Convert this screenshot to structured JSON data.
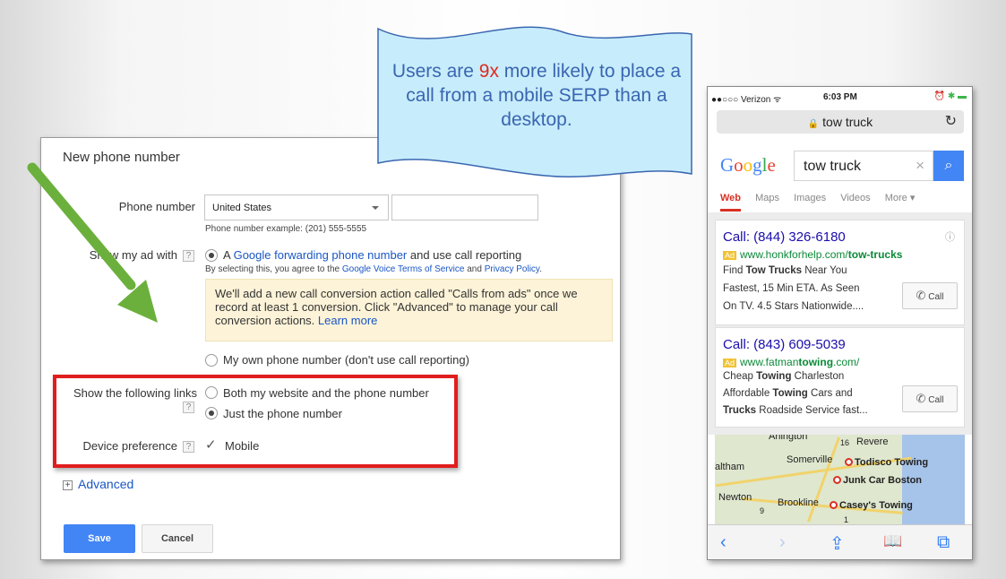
{
  "callout": {
    "text_before": "Users are ",
    "highlight": "9x",
    "text_after": " more likely to place a call from a mobile SERP than a desktop."
  },
  "dialog": {
    "title": "New phone number",
    "phone_number_label": "Phone number",
    "country_selected": "United States",
    "phone_input_value": "",
    "phone_example": "Phone number example: (201) 555-5555",
    "show_ad_label": "Show my ad with",
    "help_glyph": "?",
    "option_forwarding_prefix": "A ",
    "option_forwarding_link": "Google forwarding phone number",
    "option_forwarding_suffix": " and use call reporting",
    "terms_prefix": "By selecting this, you agree to the ",
    "terms_link": "Google Voice Terms of Service",
    "terms_and": " and ",
    "privacy_link": "Privacy Policy",
    "terms_end": ".",
    "info_text": "We'll add a new call conversion action called \"Calls from ads\" once we record at least 1 conversion. Click \"Advanced\" to manage your call conversion actions. ",
    "learn_more": "Learn more",
    "option_own_number": "My own phone number (don't use call reporting)",
    "links_label": "Show the following links",
    "links_option_both": "Both my website and the phone number",
    "links_option_phone": "Just the phone number",
    "device_label": "Device preference",
    "device_check": "✓",
    "device_option": "Mobile",
    "advanced_plus": "+",
    "advanced_label": "Advanced",
    "save_label": "Save",
    "cancel_label": "Cancel"
  },
  "phone": {
    "carrier": "●●○○○ Verizon ᯤ",
    "time": "6:03 PM",
    "status_right": "⏰ ✱ ▬",
    "url_lock": "🔒",
    "url_text": "tow truck",
    "reload": "↻",
    "logo": "Google",
    "search_value": "tow truck",
    "clear": "×",
    "search_glyph": "⌕",
    "tabs": [
      "Web",
      "Maps",
      "Images",
      "Videos",
      "More ▾"
    ],
    "ads": [
      {
        "title": "Call: (844) 326-6180",
        "badge": "Ad",
        "url_plain": "www.honkforhelp.com/",
        "url_bold": "tow-trucks",
        "line1_plain": "Find ",
        "line1_bold": "Tow Trucks",
        "line1_rest": " Near You",
        "line2": "Fastest, 15 Min ETA. As Seen",
        "line3": "On TV. 4.5 Stars Nationwide....",
        "call_label": "Call",
        "info": "ⓘ"
      },
      {
        "title": "Call: (843) 609-5039",
        "badge": "Ad",
        "url_plain": "www.fatman",
        "url_bold": "towing",
        "url_rest": ".com/",
        "line1_plain": "Cheap ",
        "line1_bold": "Towing",
        "line1_rest": " Charleston",
        "line2_plain": "Affordable ",
        "line2_bold": "Towing",
        "line2_rest": " Cars and",
        "line3_bold": "Trucks",
        "line3_rest": " Roadside Service fast...",
        "call_label": "Call"
      }
    ],
    "map": {
      "labels": [
        "Arlington",
        "Revere",
        "Waltham",
        "Somerville",
        "Newton",
        "Brookline",
        "16",
        "9",
        "1"
      ],
      "pins": [
        "Todisco Towing",
        "Junk Car Boston",
        "Casey's Towing"
      ]
    },
    "toolbar": [
      "‹",
      "›",
      "⇪",
      "📖",
      "⧉"
    ]
  },
  "colors": {
    "accent_red": "#e11d1d",
    "callout_fill": "#c7ecfb",
    "callout_text": "#3a66b0",
    "arrow_green": "#6bb03c",
    "google_blue": "#4285f4"
  }
}
